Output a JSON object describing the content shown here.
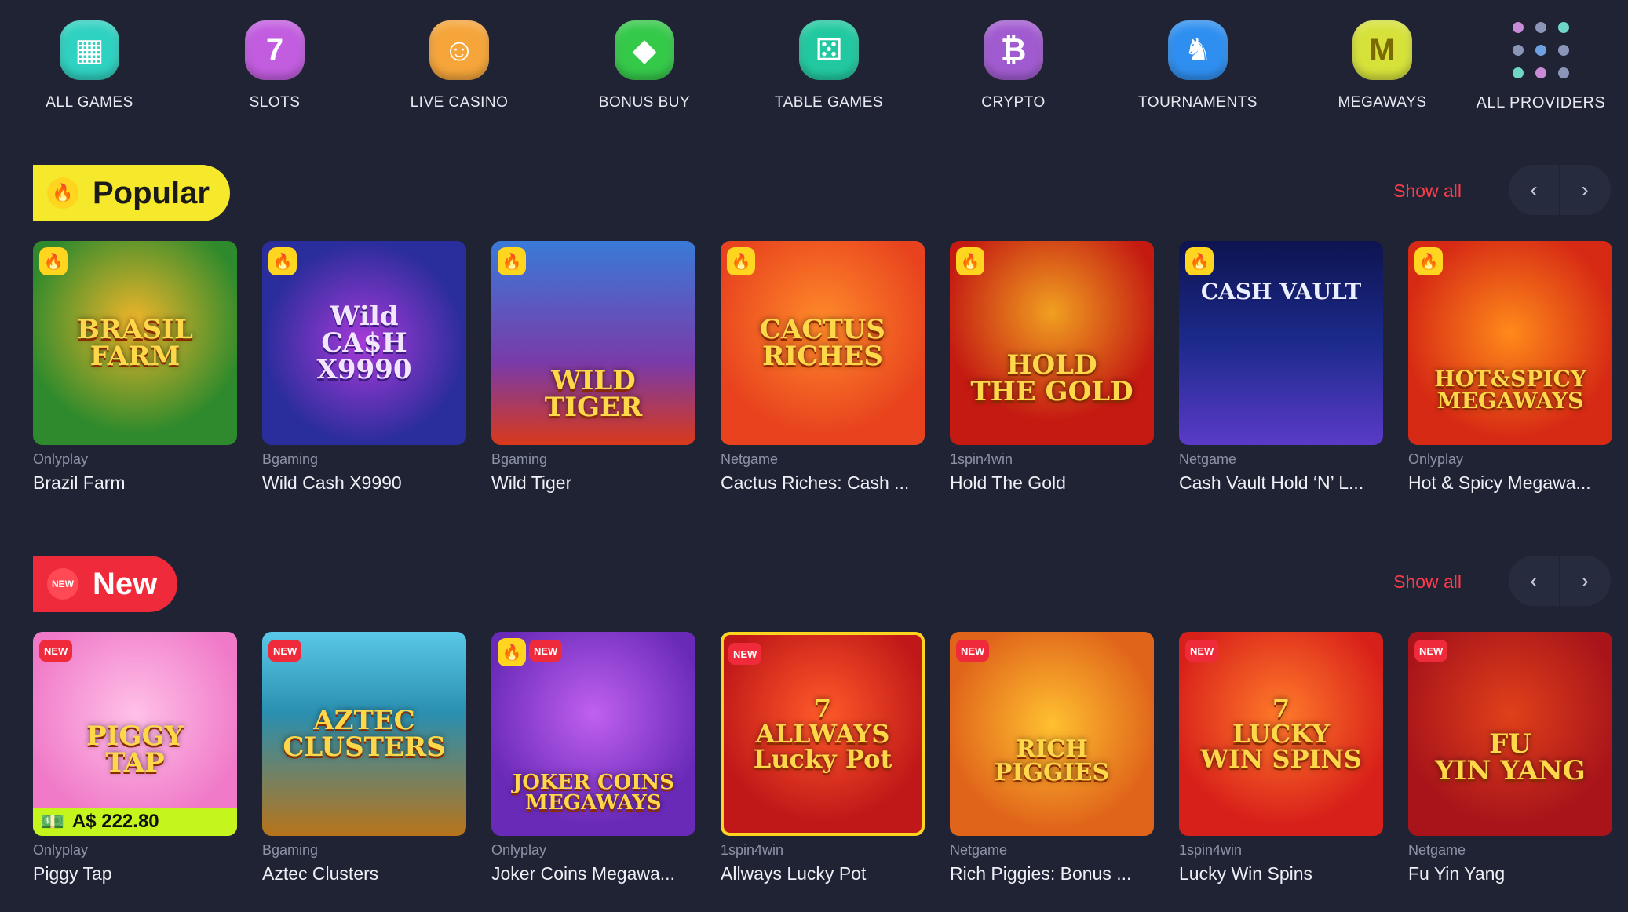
{
  "categories": [
    {
      "label": "ALL GAMES",
      "icon": "slot-bar-icon",
      "color": "#2fd1c0"
    },
    {
      "label": "SLOTS",
      "icon": "slot-machine-icon",
      "color": "#c25de0"
    },
    {
      "label": "LIVE CASINO",
      "icon": "dealer-icon",
      "color": "#f5a53a"
    },
    {
      "label": "BONUS BUY",
      "icon": "diamond-icon",
      "color": "#35c94a"
    },
    {
      "label": "TABLE GAMES",
      "icon": "dice-icon",
      "color": "#22c9a0"
    },
    {
      "label": "CRYPTO",
      "icon": "bitcoin-icon",
      "color": "#a15bd0"
    },
    {
      "label": "TOURNAMENTS",
      "icon": "chess-knight-icon",
      "color": "#2f8ff0"
    },
    {
      "label": "MEGAWAYS",
      "icon": "megaways-m-icon",
      "color": "#d6e23a"
    }
  ],
  "all_providers": {
    "label": "ALL PROVIDERS",
    "icon": "grid-dots-icon",
    "dot_colors": [
      "#c98ad6",
      "#8a95b8",
      "#6fd6c8",
      "#8a95b8",
      "#6fa0e0",
      "#8a95b8",
      "#6fd6c8",
      "#c98ad6",
      "#8a95b8"
    ]
  },
  "popular": {
    "title": "Popular",
    "show_all": "Show all",
    "games": [
      {
        "provider": "Onlyplay",
        "name": "Brazil Farm",
        "art": "BRASIL FARM",
        "bg": "#2e8a2c",
        "badges": [
          "hot"
        ]
      },
      {
        "provider": "Bgaming",
        "name": "Wild Cash X9990",
        "art": "Wild\nCA$H\nX9990",
        "bg": "#2a2d9c",
        "badges": [
          "hot"
        ]
      },
      {
        "provider": "Bgaming",
        "name": "Wild Tiger",
        "art": "WILD TIGER",
        "bg": "#7a3aa8",
        "badges": [
          "hot"
        ]
      },
      {
        "provider": "Netgame",
        "name": "Cactus Riches: Cash ...",
        "art": "CACTUS\nRICHES",
        "bg": "#e8431e",
        "badges": [
          "hot"
        ]
      },
      {
        "provider": "1spin4win",
        "name": "Hold The Gold",
        "art": "HOLD\nTHE GOLD",
        "bg": "#c41a12",
        "badges": [
          "hot"
        ]
      },
      {
        "provider": "Netgame",
        "name": "Cash Vault Hold ‘N’ L...",
        "art": "CASH VAULT",
        "bg": "#1c2a8c",
        "badges": [
          "hot"
        ]
      },
      {
        "provider": "Onlyplay",
        "name": "Hot & Spicy Megawa...",
        "art": "HOT&SPICY\nMEGAWAYS",
        "bg": "#d62a14",
        "badges": [
          "hot"
        ]
      }
    ]
  },
  "new": {
    "title": "New",
    "badge_text": "NEW",
    "show_all": "Show all",
    "games": [
      {
        "provider": "Onlyplay",
        "name": "Piggy Tap",
        "art": "PIGGY\nTAP",
        "bg": "#f07ac8",
        "badges": [
          "new"
        ],
        "jackpot": "A$ 222.80"
      },
      {
        "provider": "Bgaming",
        "name": "Aztec Clusters",
        "art": "AZTEC\nCLUSTERS",
        "bg": "#2a8fb0",
        "badges": [
          "new"
        ]
      },
      {
        "provider": "Onlyplay",
        "name": "Joker Coins Megawa...",
        "art": "JOKER COINS\nMEGAWAYS",
        "bg": "#6a2ab8",
        "badges": [
          "hot",
          "new"
        ]
      },
      {
        "provider": "1spin4win",
        "name": "Allways Lucky Pot",
        "art": "7\nALLWAYS\nLucky Pot",
        "bg": "#c01818",
        "badges": [
          "new"
        ]
      },
      {
        "provider": "Netgame",
        "name": "Rich Piggies: Bonus ...",
        "art": "RICH PIGGIES",
        "bg": "#e0641a",
        "badges": [
          "new"
        ]
      },
      {
        "provider": "1spin4win",
        "name": "Lucky Win Spins",
        "art": "7\nLUCKY\nWIN SPINS",
        "bg": "#d8201a",
        "badges": [
          "new"
        ]
      },
      {
        "provider": "Netgame",
        "name": "Fu Yin Yang",
        "art": "FU\nYIN YANG",
        "bg": "#a8141a",
        "badges": [
          "new"
        ]
      }
    ]
  }
}
